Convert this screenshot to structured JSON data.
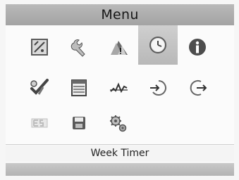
{
  "menu": {
    "title": "Menu",
    "selected_label": "Week Timer",
    "items": [
      {
        "icon": "gauge-square-icon"
      },
      {
        "icon": "wrench-icon"
      },
      {
        "icon": "triangle-warning-icon"
      },
      {
        "icon": "clock-icon",
        "selected": true
      },
      {
        "icon": "info-icon"
      },
      {
        "icon": "checkmark-tools-icon"
      },
      {
        "icon": "calendar-table-icon"
      },
      {
        "icon": "graph-line-icon"
      },
      {
        "icon": "arrow-in-circle-icon"
      },
      {
        "icon": "arrow-out-circle-icon"
      },
      {
        "icon": "es-icon"
      },
      {
        "icon": "save-icon"
      },
      {
        "icon": "gears-icon"
      }
    ]
  }
}
